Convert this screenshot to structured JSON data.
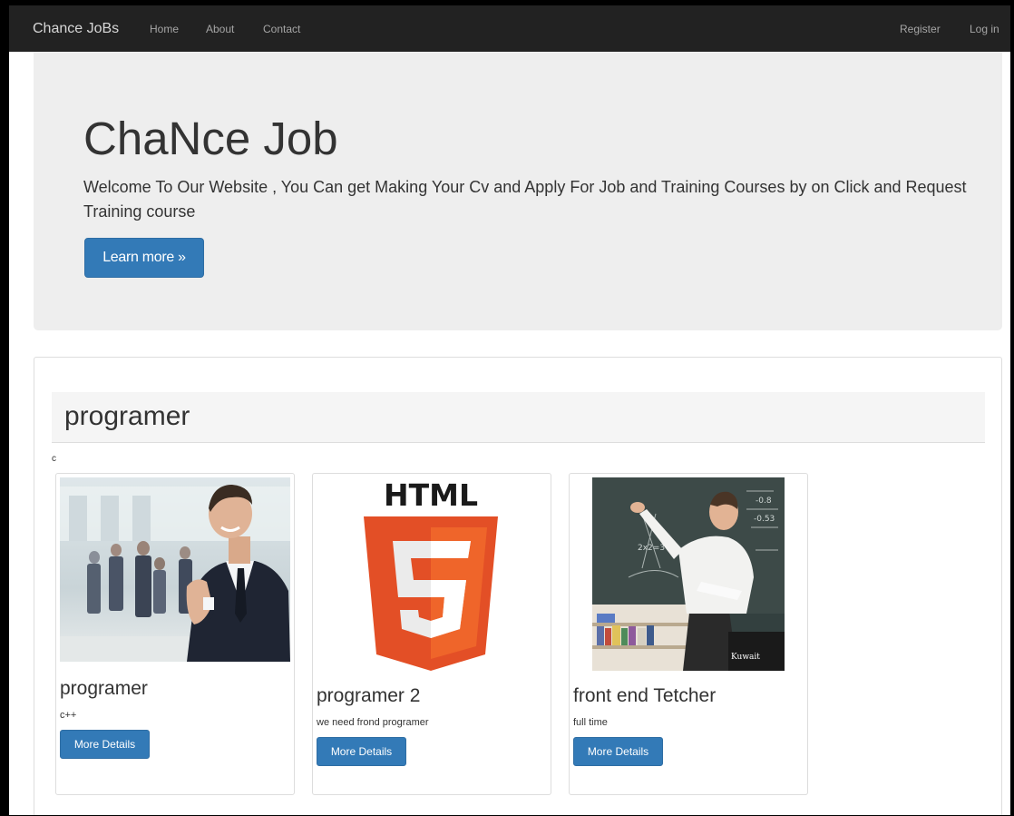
{
  "navbar": {
    "brand": "Chance JoBs",
    "links": [
      "Home",
      "About",
      "Contact"
    ],
    "right_links": [
      "Register",
      "Log in"
    ]
  },
  "hero": {
    "title": "ChaNce Job",
    "text": "Welcome To Our Website , You Can get Making Your Cv and Apply For Job and Training Courses by on Click and Request Training course",
    "button": "Learn more »"
  },
  "section": {
    "title": "programer",
    "stray_text": "c"
  },
  "cards": [
    {
      "title": "programer",
      "desc": "c++",
      "button": "More Details",
      "image": "businessman-handshake-photo"
    },
    {
      "title": "programer 2",
      "desc": "we need frond programer",
      "button": "More Details",
      "image": "html5-logo",
      "logo_text": "HTML"
    },
    {
      "title": "front end Tetcher",
      "desc": "full time",
      "button": "More Details",
      "image": "teacher-at-blackboard-photo",
      "watermark": "Kuwait"
    }
  ]
}
